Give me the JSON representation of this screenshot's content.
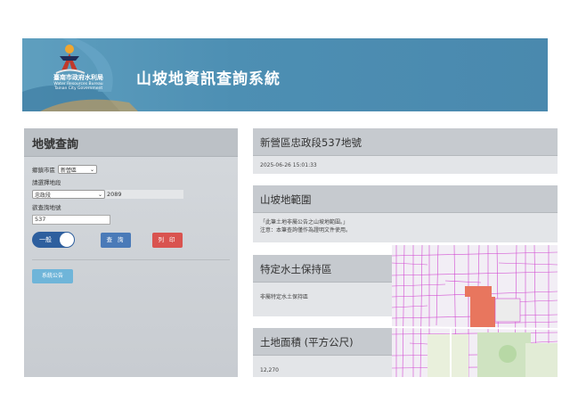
{
  "header": {
    "org_name": "臺南市政府水利局",
    "org_name_en_1": "Water Resources Bureau",
    "org_name_en_2": "Tainan City Government",
    "title": "山坡地資訊查詢系統"
  },
  "lot_query": {
    "title": "地號查詢",
    "district_label": "鄉鎮市區",
    "district_value": "新營區",
    "section_label": "請選擇地段",
    "section_value": "忠政段",
    "section_code": "2089",
    "lot_label": "欲查詢地號",
    "lot_value": "537",
    "toggle_label": "一般",
    "search_button": "查 詢",
    "print_button": "列 印",
    "notice_button": "系統公告"
  },
  "result": {
    "address_title": "新營區忠政段537地號",
    "timestamp": "2025-06-26 15:01:33",
    "range_title": "山坡地範圍",
    "range_line_1": "「此筆土地非屬公告之山坡地範圍。」",
    "range_line_2": "注意：本筆查詢僅作為證明文件使用。",
    "zone_title": "特定水土保持區",
    "zone_value": "非屬特定水土保持區",
    "area_title": "土地面積 (平方公尺)",
    "area_value": "12,270"
  },
  "colors": {
    "header_bg": "#4d8fb3",
    "toggle_bg": "#2e5f9e",
    "search_button": "#4a7ab8",
    "print_button": "#d9534f",
    "notice_button": "#6fb5d9",
    "parcel_highlight": "#e8765e",
    "map_lines": "#d24bd2"
  }
}
